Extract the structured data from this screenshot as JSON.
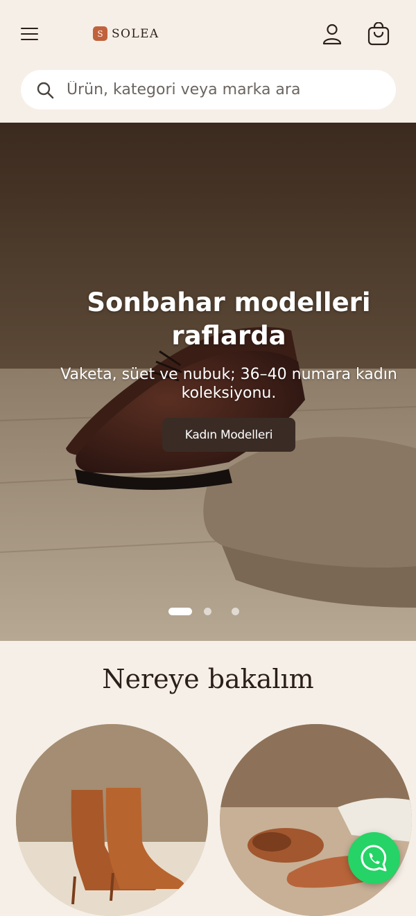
{
  "header": {
    "logo_letter": "S",
    "brand": "SOLEA",
    "icons": [
      "menu-icon",
      "user-icon",
      "shopping-bag-icon"
    ]
  },
  "search": {
    "placeholder": "Ürün, kategori veya marka ara",
    "icon": "search-icon"
  },
  "hero": {
    "title": "Sonbahar modelleri raflarda",
    "subtitle": "Vaketa, süet ve nubuk; 36–40 numara kadın koleksiyonu.",
    "cta_label": "Kadın Modelleri",
    "slides_total": 3,
    "active_slide": 1
  },
  "categories_section": {
    "title": "Nereye bakalım",
    "items": [
      "category-ankle-boots",
      "category-flats"
    ]
  },
  "colors": {
    "background": "#f6efe7",
    "accent": "#c0623c",
    "cta": "#3a2c25",
    "whatsapp": "#25d366"
  }
}
